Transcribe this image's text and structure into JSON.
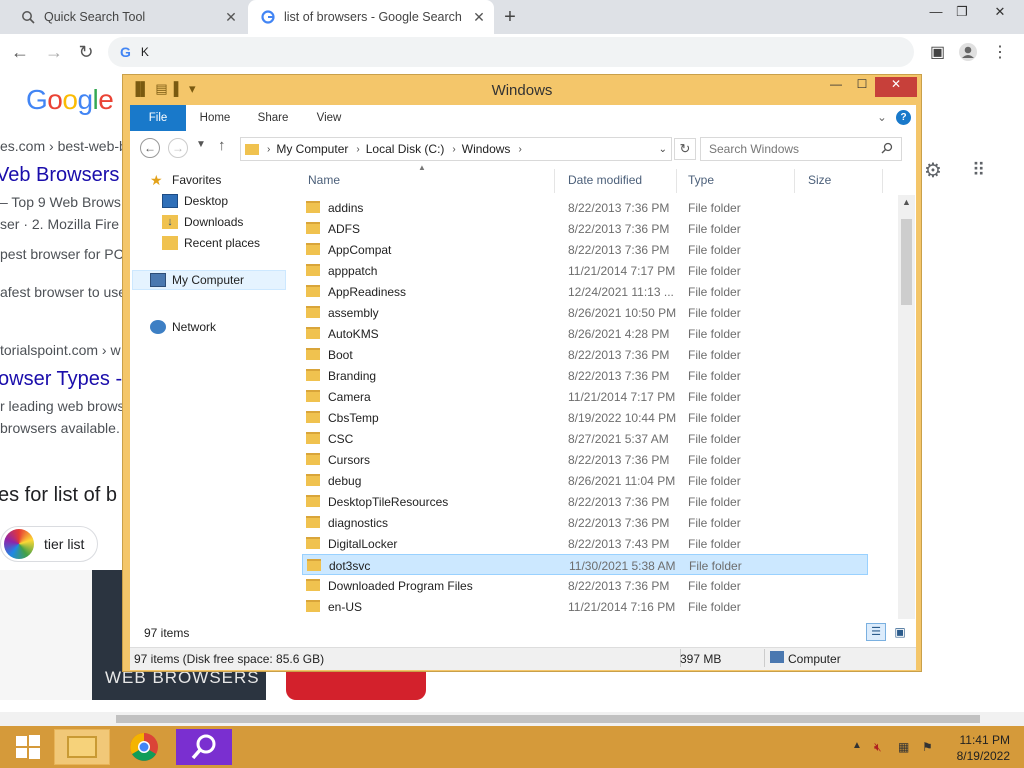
{
  "browser": {
    "tabs": [
      {
        "title": "Quick Search Tool",
        "icon": "search-icon"
      },
      {
        "title": "list of browsers - Google Search",
        "icon": "google-icon"
      }
    ],
    "address_text": "K",
    "new_tab_glyph": "+"
  },
  "google_page": {
    "logo": "Google",
    "snippets": {
      "url1": "es.com › best-web-b",
      "title1": "Veb Browsers",
      "line1": "– Top 9 Web Brows",
      "line2": "ser · 2. Mozilla Fire",
      "line3": "pest browser for PC",
      "line4": "afest browser to use",
      "url2": "torialspoint.com › w",
      "title2": "owser Types -",
      "line5": "r leading web brows",
      "line6": "browsers available.",
      "related": "es for list of b",
      "chip": "tier list",
      "banner": "WEB BROWSERS"
    }
  },
  "explorer": {
    "title": "Windows",
    "ribbon_tabs": [
      "File",
      "Home",
      "Share",
      "View"
    ],
    "address": [
      "My Computer",
      "Local Disk (C:)",
      "Windows"
    ],
    "search_placeholder": "Search Windows",
    "nav": {
      "favorites": "Favorites",
      "desktop": "Desktop",
      "downloads": "Downloads",
      "recent": "Recent places",
      "computer": "My Computer",
      "network": "Network"
    },
    "columns": {
      "name": "Name",
      "date": "Date modified",
      "type": "Type",
      "size": "Size"
    },
    "files": [
      {
        "name": "addins",
        "date": "8/22/2013 7:36 PM",
        "type": "File folder"
      },
      {
        "name": "ADFS",
        "date": "8/22/2013 7:36 PM",
        "type": "File folder"
      },
      {
        "name": "AppCompat",
        "date": "8/22/2013 7:36 PM",
        "type": "File folder"
      },
      {
        "name": "apppatch",
        "date": "11/21/2014 7:17 PM",
        "type": "File folder"
      },
      {
        "name": "AppReadiness",
        "date": "12/24/2021 11:13 ...",
        "type": "File folder"
      },
      {
        "name": "assembly",
        "date": "8/26/2021 10:50 PM",
        "type": "File folder"
      },
      {
        "name": "AutoKMS",
        "date": "8/26/2021 4:28 PM",
        "type": "File folder"
      },
      {
        "name": "Boot",
        "date": "8/22/2013 7:36 PM",
        "type": "File folder"
      },
      {
        "name": "Branding",
        "date": "8/22/2013 7:36 PM",
        "type": "File folder"
      },
      {
        "name": "Camera",
        "date": "11/21/2014 7:17 PM",
        "type": "File folder"
      },
      {
        "name": "CbsTemp",
        "date": "8/19/2022 10:44 PM",
        "type": "File folder"
      },
      {
        "name": "CSC",
        "date": "8/27/2021 5:37 AM",
        "type": "File folder"
      },
      {
        "name": "Cursors",
        "date": "8/22/2013 7:36 PM",
        "type": "File folder"
      },
      {
        "name": "debug",
        "date": "8/26/2021 11:04 PM",
        "type": "File folder"
      },
      {
        "name": "DesktopTileResources",
        "date": "8/22/2013 7:36 PM",
        "type": "File folder"
      },
      {
        "name": "diagnostics",
        "date": "8/22/2013 7:36 PM",
        "type": "File folder"
      },
      {
        "name": "DigitalLocker",
        "date": "8/22/2013 7:43 PM",
        "type": "File folder"
      },
      {
        "name": "dot3svc",
        "date": "11/30/2021 5:38 AM",
        "type": "File folder",
        "selected": true
      },
      {
        "name": "Downloaded Program Files",
        "date": "8/22/2013 7:36 PM",
        "type": "File folder"
      },
      {
        "name": "en-US",
        "date": "11/21/2014 7:16 PM",
        "type": "File folder"
      }
    ],
    "item_count": "97 items",
    "status_left": "97 items (Disk free space: 85.6 GB)",
    "status_size": "397 MB",
    "status_location": "Computer"
  },
  "taskbar": {
    "clock_time": "11:41 PM",
    "clock_date": "8/19/2022"
  },
  "colors": {
    "explorer_frame": "#f4c66a",
    "taskbar": "#d59a3a",
    "selection": "#cce8ff",
    "file_tab": "#1979ca"
  }
}
